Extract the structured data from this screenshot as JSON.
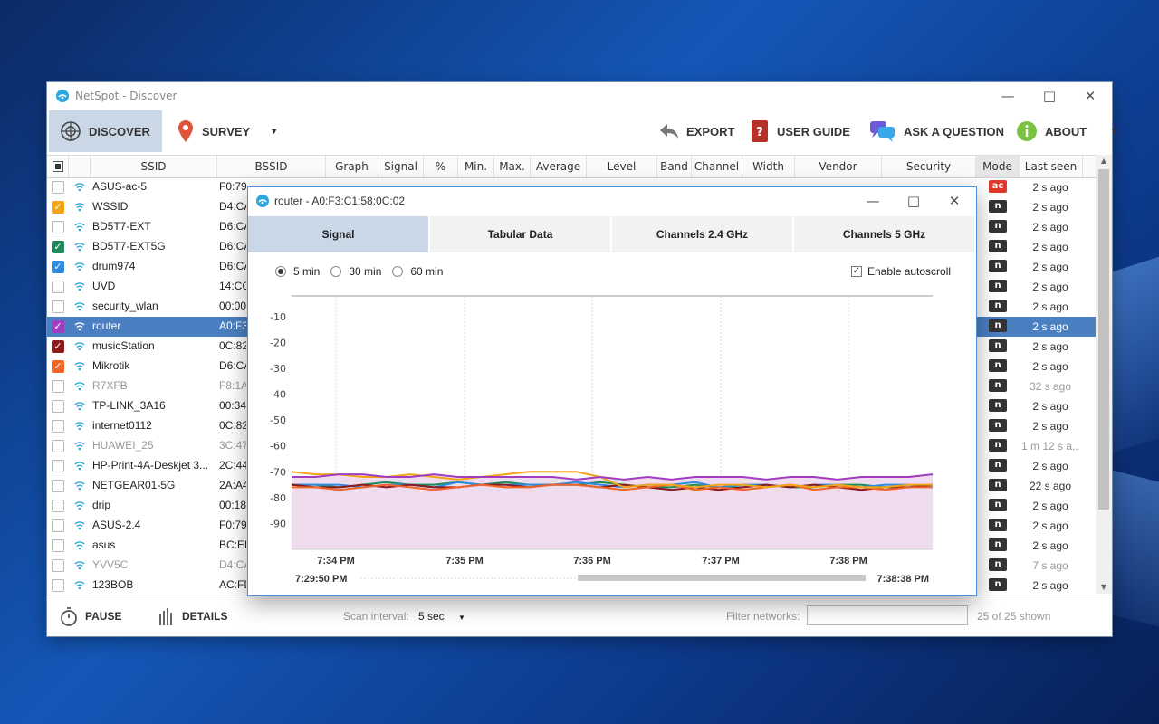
{
  "window": {
    "title": "NetSpot - Discover"
  },
  "toolbar": {
    "discover": "DISCOVER",
    "survey": "SURVEY",
    "export": "EXPORT",
    "user_guide": "USER GUIDE",
    "ask": "ASK A QUESTION",
    "about": "ABOUT"
  },
  "columns": [
    "SSID",
    "BSSID",
    "Graph",
    "Signal",
    "%",
    "Min.",
    "Max.",
    "Average",
    "Level",
    "Band",
    "Channel",
    "Width",
    "Vendor",
    "Security",
    "Mode",
    "Last seen"
  ],
  "networks": [
    {
      "ssid": "ASUS-ac-5",
      "bssid": "F0:79:59:EB:82:2C",
      "checked": false,
      "color": "",
      "mode": "ac",
      "seen": "2 s ago",
      "dim": false
    },
    {
      "ssid": "WSSID",
      "bssid": "D4:CA",
      "checked": true,
      "color": "#f2a516",
      "mode": "n",
      "seen": "2 s ago",
      "dim": false
    },
    {
      "ssid": "BD5T7-EXT",
      "bssid": "D6:CA",
      "checked": false,
      "color": "",
      "mode": "n",
      "seen": "2 s ago",
      "dim": false
    },
    {
      "ssid": "BD5T7-EXT5G",
      "bssid": "D6:CA",
      "checked": true,
      "color": "#1e8a5a",
      "mode": "n",
      "seen": "2 s ago",
      "dim": false
    },
    {
      "ssid": "drum974",
      "bssid": "D6:CA",
      "checked": true,
      "color": "#2f8be0",
      "mode": "n",
      "seen": "2 s ago",
      "dim": false
    },
    {
      "ssid": "UVD",
      "bssid": "14:CC",
      "checked": false,
      "color": "",
      "mode": "n",
      "seen": "2 s ago",
      "dim": false
    },
    {
      "ssid": "security_wlan",
      "bssid": "00:00",
      "checked": false,
      "color": "",
      "mode": "n",
      "seen": "2 s ago",
      "dim": false
    },
    {
      "ssid": "router",
      "bssid": "A0:F3",
      "checked": true,
      "color": "#a23cc0",
      "mode": "n",
      "seen": "2 s ago",
      "dim": false,
      "selected": true
    },
    {
      "ssid": "musicStation",
      "bssid": "0C:82",
      "checked": true,
      "color": "#8b1a1a",
      "mode": "n",
      "seen": "2 s ago",
      "dim": false
    },
    {
      "ssid": "Mikrotik",
      "bssid": "D6:CA",
      "checked": true,
      "color": "#f0662a",
      "mode": "n",
      "seen": "2 s ago",
      "dim": false
    },
    {
      "ssid": "R7XFB",
      "bssid": "F8:1A",
      "checked": false,
      "color": "",
      "mode": "n",
      "seen": "32 s ago",
      "dim": true
    },
    {
      "ssid": "TP-LINK_3A16",
      "bssid": "00:34",
      "checked": false,
      "color": "",
      "mode": "n",
      "seen": "2 s ago",
      "dim": false
    },
    {
      "ssid": "internet0112",
      "bssid": "0C:82",
      "checked": false,
      "color": "",
      "mode": "n",
      "seen": "2 s ago",
      "dim": false
    },
    {
      "ssid": "HUAWEI_25",
      "bssid": "3C:47",
      "checked": false,
      "color": "",
      "mode": "n",
      "seen": "1 m 12 s a...",
      "dim": true
    },
    {
      "ssid": "HP-Print-4A-Deskjet 3...",
      "bssid": "2C:44",
      "checked": false,
      "color": "",
      "mode": "n",
      "seen": "2 s ago",
      "dim": false
    },
    {
      "ssid": "NETGEAR01-5G",
      "bssid": "2A:A4",
      "checked": false,
      "color": "",
      "mode": "n",
      "seen": "22 s ago",
      "dim": false
    },
    {
      "ssid": "drip",
      "bssid": "00:18",
      "checked": false,
      "color": "",
      "mode": "n",
      "seen": "2 s ago",
      "dim": false
    },
    {
      "ssid": "ASUS-2.4",
      "bssid": "F0:79",
      "checked": false,
      "color": "",
      "mode": "n",
      "seen": "2 s ago",
      "dim": false
    },
    {
      "ssid": "asus",
      "bssid": "BC:EE",
      "checked": false,
      "color": "",
      "mode": "n",
      "seen": "2 s ago",
      "dim": false
    },
    {
      "ssid": "YVV5C",
      "bssid": "D4:CA",
      "checked": false,
      "color": "",
      "mode": "n",
      "seen": "7 s ago",
      "dim": true
    },
    {
      "ssid": "123BOB",
      "bssid": "AC:FD",
      "checked": false,
      "color": "",
      "mode": "n",
      "seen": "2 s ago",
      "dim": false
    }
  ],
  "footer": {
    "pause": "PAUSE",
    "details": "DETAILS",
    "scan_label": "Scan interval:",
    "scan_value": "5 sec",
    "filter_label": "Filter networks:",
    "filter_value": "",
    "shown": "25 of 25 shown"
  },
  "popup": {
    "title": "router - A0:F3:C1:58:0C:02",
    "tabs": [
      "Signal",
      "Tabular Data",
      "Channels 2.4 GHz",
      "Channels 5 GHz"
    ],
    "ranges": [
      "5 min",
      "30 min",
      "60 min"
    ],
    "selected_range": "5 min",
    "autoscroll": "Enable autoscroll",
    "autoscroll_checked": true,
    "range_start": "7:29:50 PM",
    "range_end": "7:38:38 PM"
  },
  "chart_data": {
    "type": "line",
    "y_ticks": [
      -10,
      -20,
      -30,
      -40,
      -50,
      -60,
      -70,
      -80,
      -90
    ],
    "ylim": [
      -100,
      -2
    ],
    "x_ticks": [
      "7:34 PM",
      "7:35 PM",
      "7:36 PM",
      "7:37 PM",
      "7:38 PM"
    ],
    "series": [
      {
        "color": "#a23cc0",
        "values": [
          -72,
          -72,
          -71,
          -71,
          -72,
          -72,
          -71,
          -72,
          -72,
          -72,
          -72,
          -72,
          -73,
          -72,
          -73,
          -72,
          -73,
          -72,
          -72,
          -72,
          -73,
          -72,
          -72,
          -73,
          -72,
          -72,
          -72,
          -71
        ]
      },
      {
        "color": "#f2a516",
        "values": [
          -70,
          -71,
          -71,
          -72,
          -72,
          -71,
          -72,
          -73,
          -72,
          -71,
          -70,
          -70,
          -70,
          -72,
          -76,
          -75,
          -75,
          -76,
          -75,
          -75,
          -76,
          -75,
          -76,
          -75,
          -76,
          -76,
          -75,
          -75
        ]
      },
      {
        "color": "#f0662a",
        "values": [
          -76,
          -76,
          -77,
          -76,
          -75,
          -76,
          -77,
          -76,
          -75,
          -76,
          -76,
          -75,
          -75,
          -76,
          -77,
          -76,
          -75,
          -77,
          -76,
          -77,
          -76,
          -75,
          -77,
          -76,
          -76,
          -77,
          -76,
          -76
        ]
      },
      {
        "color": "#8b1a1a",
        "values": [
          -75,
          -76,
          -76,
          -75,
          -76,
          -75,
          -76,
          -76,
          -75,
          -75,
          -76,
          -75,
          -75,
          -76,
          -75,
          -76,
          -77,
          -76,
          -77,
          -76,
          -75,
          -76,
          -75,
          -76,
          -77,
          -76,
          -76,
          -75
        ]
      },
      {
        "color": "#2f8be0",
        "values": [
          -75,
          -75,
          -75,
          -76,
          -75,
          -75,
          -76,
          -74,
          -75,
          -75,
          -75,
          -75,
          -74,
          -75,
          -76,
          -75,
          -75,
          -74,
          -76,
          -75,
          -75,
          -76,
          -75,
          -75,
          -76,
          -75,
          -75,
          -76
        ]
      },
      {
        "color": "#1e8a5a",
        "values": [
          -75,
          -75,
          -76,
          -75,
          -74,
          -75,
          -75,
          -74,
          -75,
          -74,
          -75,
          -75,
          -75,
          -74,
          -75,
          -76,
          -76,
          -75,
          -76,
          -76,
          -75,
          -76,
          -76,
          -75,
          -75,
          -76,
          -76,
          -75
        ]
      }
    ]
  }
}
